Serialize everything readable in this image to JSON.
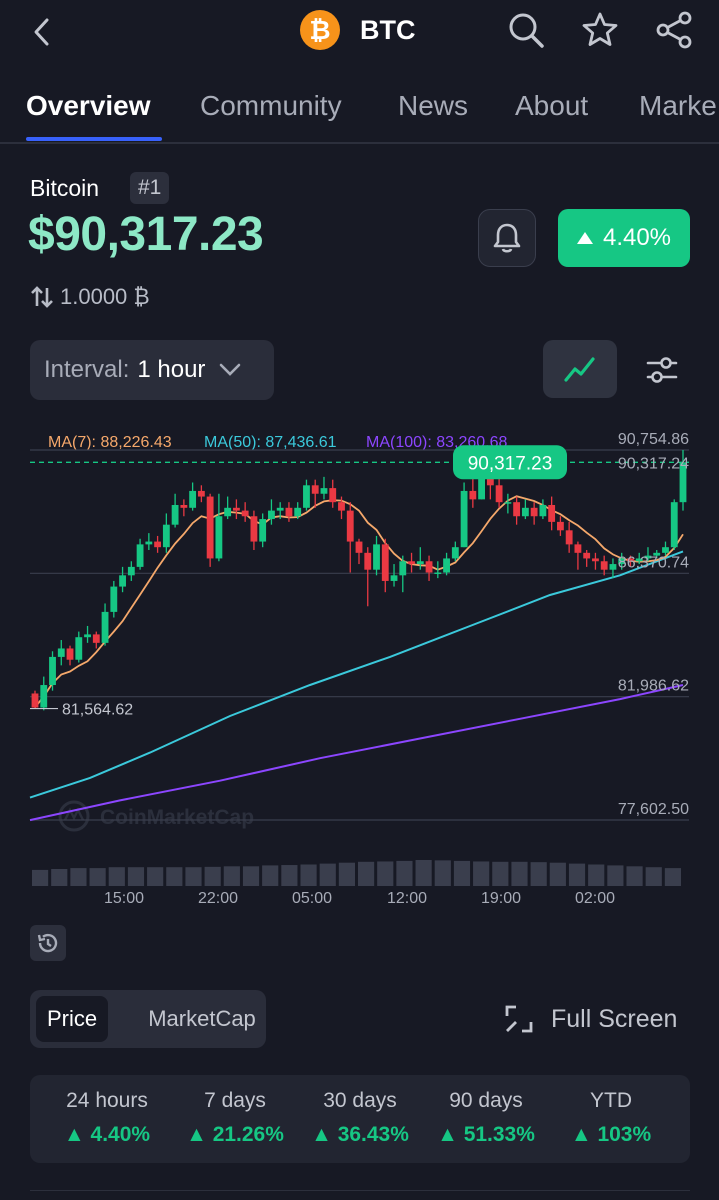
{
  "header": {
    "back_icon": "chevron-left-icon",
    "coin_logo": "₿",
    "symbol": "BTC",
    "icons": [
      "search-icon",
      "star-icon",
      "share-icon"
    ]
  },
  "tabs": [
    {
      "label": "Overview",
      "active": true
    },
    {
      "label": "Community"
    },
    {
      "label": "News"
    },
    {
      "label": "About"
    },
    {
      "label": "Marke"
    }
  ],
  "coin": {
    "name": "Bitcoin",
    "rank": "#1",
    "price": "$90,317.23",
    "change": "4.40%",
    "amount": "1.0000 ₿"
  },
  "interval": {
    "label": "Interval:",
    "value": "1 hour"
  },
  "chart_data": {
    "type": "candlestick",
    "indicators": [
      {
        "label": "MA(7): 88,226.43",
        "color": "#f5a86b"
      },
      {
        "label": "MA(50): 87,436.61",
        "color": "#3bc9db"
      },
      {
        "label": "MA(100): 83,260.68",
        "color": "#8c46ff"
      }
    ],
    "current_price_label": "90,317.23",
    "price_labels": [
      "90,754.86",
      "90,317.24",
      "86,370.74",
      "81,986.62",
      "77,602.50"
    ],
    "low_label": "81,564.62",
    "time_labels": [
      "15:00",
      "22:00",
      "05:00",
      "12:00",
      "19:00",
      "02:00"
    ],
    "watermark": "CoinMarketCap",
    "ylim": [
      77602.5,
      90754.86
    ],
    "candles": [
      [
        82100,
        81600,
        82200,
        81564.62
      ],
      [
        81600,
        82400,
        82700,
        81500
      ],
      [
        82400,
        83400,
        83600,
        82200
      ],
      [
        83400,
        83700,
        84000,
        83100
      ],
      [
        83700,
        83300,
        83800,
        83100
      ],
      [
        83300,
        84100,
        84300,
        83200
      ],
      [
        84100,
        84200,
        84500,
        83900
      ],
      [
        84200,
        83900,
        84300,
        83700
      ],
      [
        83900,
        85000,
        85300,
        83800
      ],
      [
        85000,
        85900,
        86100,
        84800
      ],
      [
        85900,
        86300,
        86600,
        85700
      ],
      [
        86300,
        86600,
        86800,
        86100
      ],
      [
        86600,
        87400,
        87600,
        86500
      ],
      [
        87400,
        87500,
        87800,
        87200
      ],
      [
        87500,
        87300,
        87700,
        87100
      ],
      [
        87300,
        88100,
        88500,
        87100
      ],
      [
        88100,
        88800,
        89200,
        88000
      ],
      [
        88800,
        88700,
        89000,
        88400
      ],
      [
        88700,
        89300,
        89600,
        88600
      ],
      [
        89300,
        89100,
        89500,
        88900
      ],
      [
        89100,
        86900,
        89200,
        86600
      ],
      [
        86900,
        88400,
        89200,
        86800
      ],
      [
        88400,
        88700,
        89100,
        88300
      ],
      [
        88700,
        88600,
        89000,
        88300
      ],
      [
        88600,
        88400,
        88900,
        88200
      ],
      [
        88400,
        87500,
        88600,
        87200
      ],
      [
        87500,
        88300,
        88500,
        87300
      ],
      [
        88300,
        88600,
        89000,
        88100
      ],
      [
        88600,
        88700,
        88900,
        88300
      ],
      [
        88700,
        88400,
        88900,
        88200
      ],
      [
        88400,
        88700,
        88900,
        88300
      ],
      [
        88700,
        89500,
        89700,
        88600
      ],
      [
        89500,
        89200,
        89700,
        88700
      ],
      [
        89200,
        89400,
        89800,
        89000
      ],
      [
        89400,
        88900,
        89700,
        88700
      ],
      [
        88900,
        88600,
        89100,
        88300
      ],
      [
        88600,
        87500,
        88900,
        86400
      ],
      [
        87500,
        87100,
        87600,
        86700
      ],
      [
        87100,
        86500,
        87300,
        85200
      ],
      [
        86500,
        87400,
        87700,
        86300
      ],
      [
        87400,
        86100,
        87600,
        85700
      ],
      [
        86100,
        86300,
        86700,
        85900
      ],
      [
        86300,
        86800,
        87000,
        85700
      ],
      [
        86800,
        86700,
        87100,
        86400
      ],
      [
        86700,
        86800,
        87300,
        86500
      ],
      [
        86800,
        86400,
        87000,
        86100
      ],
      [
        86400,
        86400,
        86800,
        86200
      ],
      [
        86400,
        86900,
        87100,
        86300
      ],
      [
        86900,
        87300,
        87500,
        86800
      ],
      [
        87300,
        89300,
        89600,
        87300
      ],
      [
        89300,
        89000,
        89800,
        88700
      ],
      [
        89000,
        89800,
        90000,
        89000
      ],
      [
        89800,
        89500,
        89900,
        89000
      ],
      [
        89500,
        88900,
        89800,
        88700
      ],
      [
        88900,
        88900,
        89200,
        88500
      ],
      [
        88900,
        88400,
        89100,
        88100
      ],
      [
        88400,
        88700,
        89000,
        88300
      ],
      [
        88700,
        88400,
        88900,
        88100
      ],
      [
        88400,
        88800,
        89000,
        88300
      ],
      [
        88800,
        88200,
        89100,
        87900
      ],
      [
        88200,
        87900,
        88400,
        87700
      ],
      [
        87900,
        87400,
        88200,
        87100
      ],
      [
        87400,
        87100,
        87500,
        86500
      ],
      [
        87100,
        86900,
        87200,
        86600
      ],
      [
        86900,
        86800,
        87100,
        86500
      ],
      [
        86800,
        86500,
        87000,
        86300
      ],
      [
        86500,
        86700,
        86900,
        86200
      ],
      [
        86700,
        86900,
        87100,
        86500
      ],
      [
        86900,
        86800,
        87000,
        86600
      ],
      [
        86800,
        86900,
        87100,
        86700
      ],
      [
        86900,
        87000,
        87300,
        86800
      ],
      [
        87000,
        87100,
        87200,
        86900
      ],
      [
        87100,
        87300,
        87500,
        87000
      ],
      [
        87300,
        88900,
        89000,
        87200
      ],
      [
        88900,
        90317.23,
        90754.86,
        88600
      ]
    ]
  },
  "toggle": {
    "price": "Price",
    "marketcap": "MarketCap"
  },
  "fullscreen_label": "Full Screen",
  "performance": [
    {
      "label": "24 hours",
      "value": "4.40%"
    },
    {
      "label": "7 days",
      "value": "21.26%"
    },
    {
      "label": "30 days",
      "value": "36.43%"
    },
    {
      "label": "90 days",
      "value": "51.33%"
    },
    {
      "label": "YTD",
      "value": "103%"
    }
  ],
  "colors": {
    "up": "#16c784",
    "down": "#ea3943",
    "accent": "#3861fb",
    "price": "#8de8c6"
  }
}
